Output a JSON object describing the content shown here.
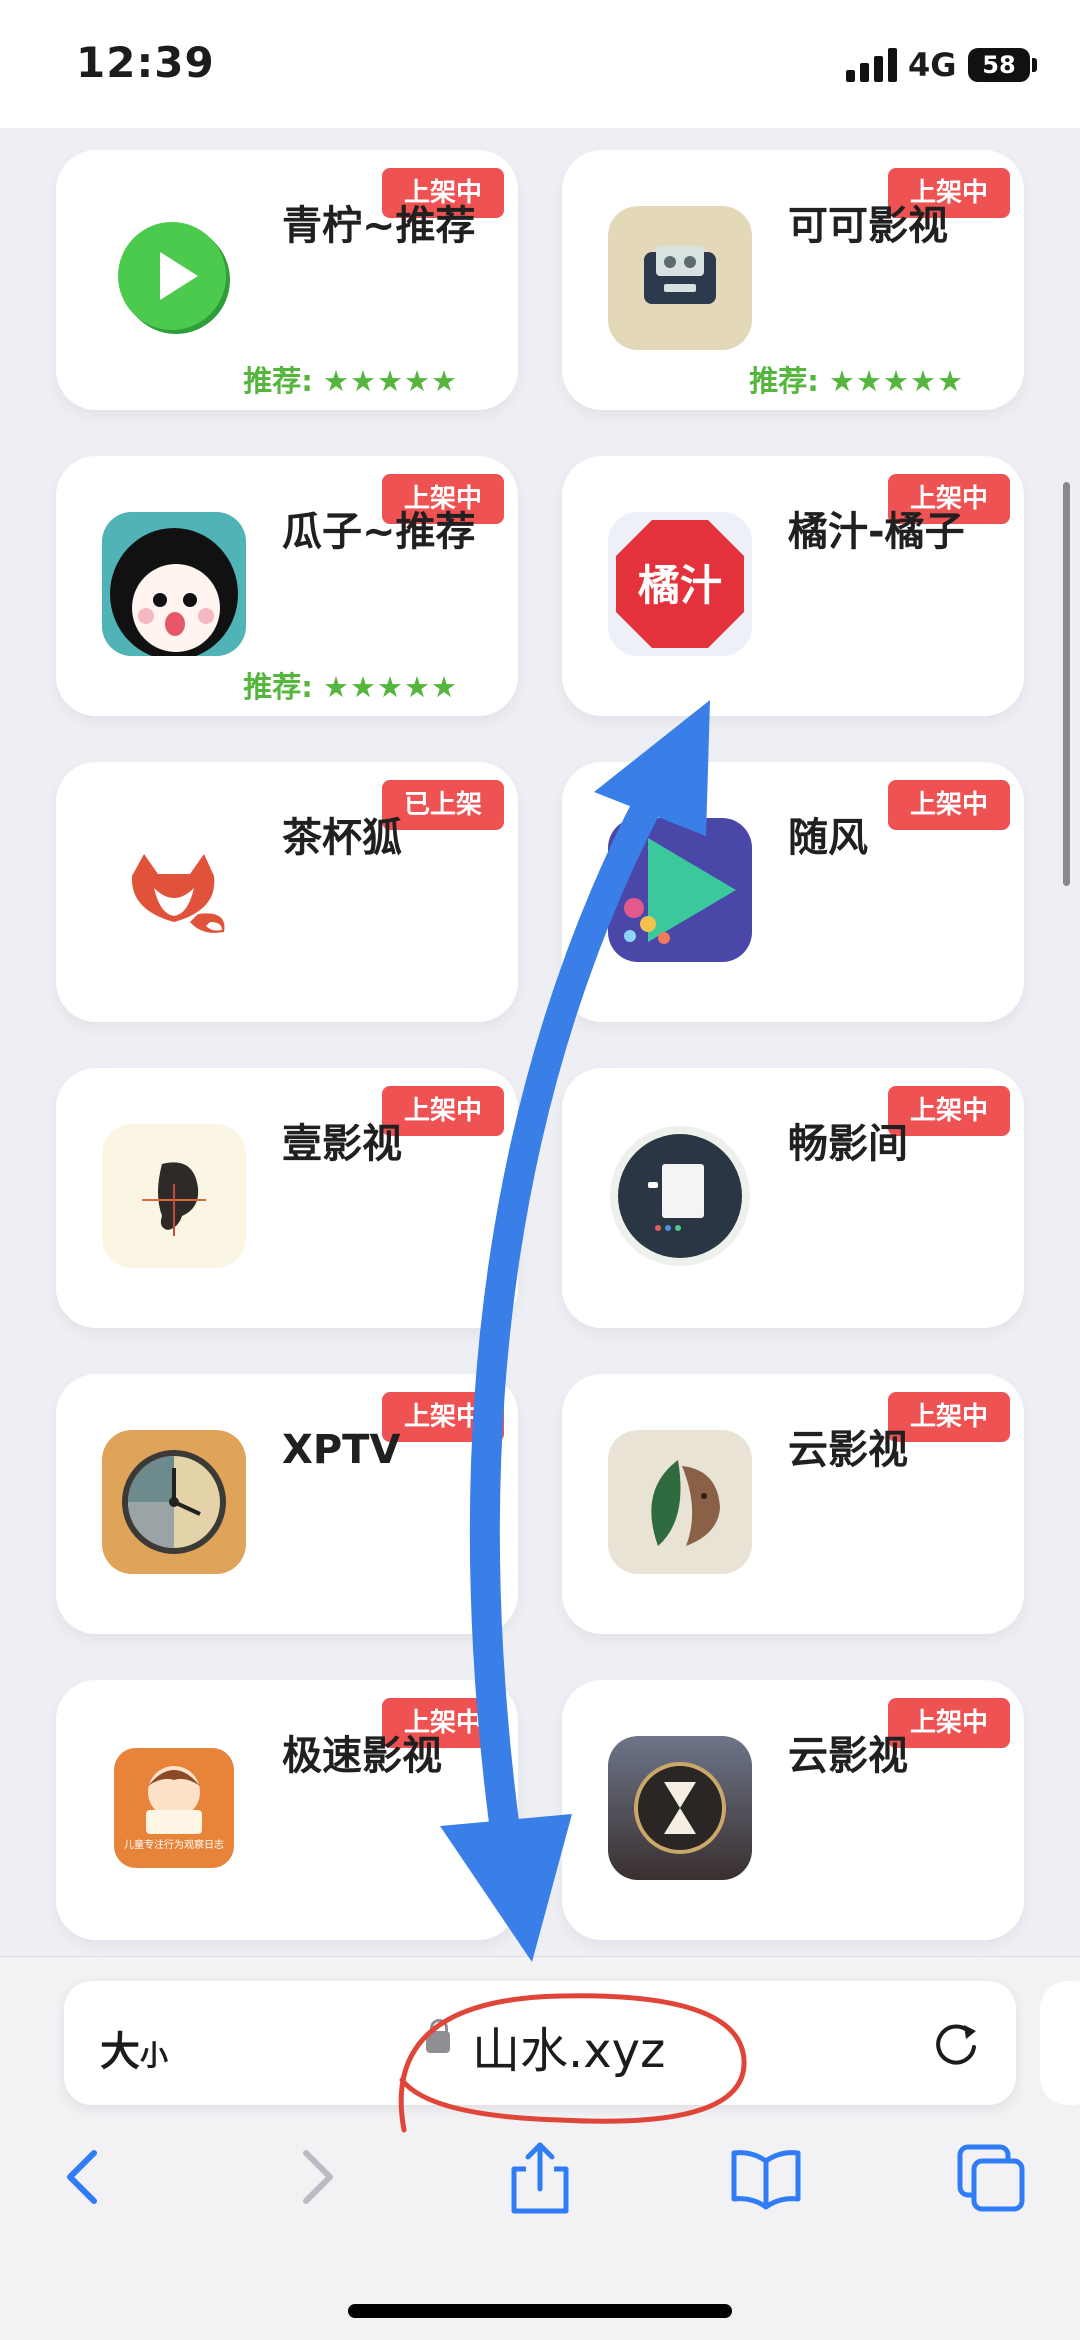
{
  "status": {
    "time": "12:39",
    "network": "4G",
    "battery": "58"
  },
  "apps": [
    {
      "name": "青柠~推荐",
      "badge": "上架中",
      "rating_label": "推荐:",
      "stars": "★★★★★",
      "icon": "green-play-icon"
    },
    {
      "name": "可可影视",
      "badge": "上架中",
      "rating_label": "推荐:",
      "stars": "★★★★★",
      "icon": "retro-tv-icon"
    },
    {
      "name": "瓜子~推荐",
      "badge": "上架中",
      "rating_label": "推荐:",
      "stars": "★★★★★",
      "icon": "cartoon-face-icon"
    },
    {
      "name": "橘汁-橘子",
      "badge": "上架中",
      "icon": "orange-juice-icon",
      "icon_text": "橘汁"
    },
    {
      "name": "茶杯狐",
      "badge": "已上架",
      "icon": "fox-icon"
    },
    {
      "name": "随风",
      "badge": "上架中",
      "icon": "purple-play-icon"
    },
    {
      "name": "壹影视",
      "badge": "上架中",
      "icon": "ear-icon"
    },
    {
      "name": "畅影间",
      "badge": "上架中",
      "icon": "document-circle-icon"
    },
    {
      "name": "XPTV",
      "badge": "上架中",
      "icon": "clock-icon"
    },
    {
      "name": "云影视",
      "badge": "上架中",
      "icon": "leaf-lion-icon"
    },
    {
      "name": "极速影视",
      "badge": "上架中",
      "icon": "reading-child-icon",
      "icon_text": "儿童专注行为观察日志"
    },
    {
      "name": "云影视",
      "badge": "上架中",
      "icon": "hourglass-icon"
    }
  ],
  "browser": {
    "text_size_label": "大",
    "text_size_small": "小",
    "url": "山水.xyz"
  },
  "colors": {
    "badge": "#ee5252",
    "rating": "#55b53d",
    "annotation_arrow": "#3a7ee8",
    "annotation_circle": "#e0453a"
  }
}
